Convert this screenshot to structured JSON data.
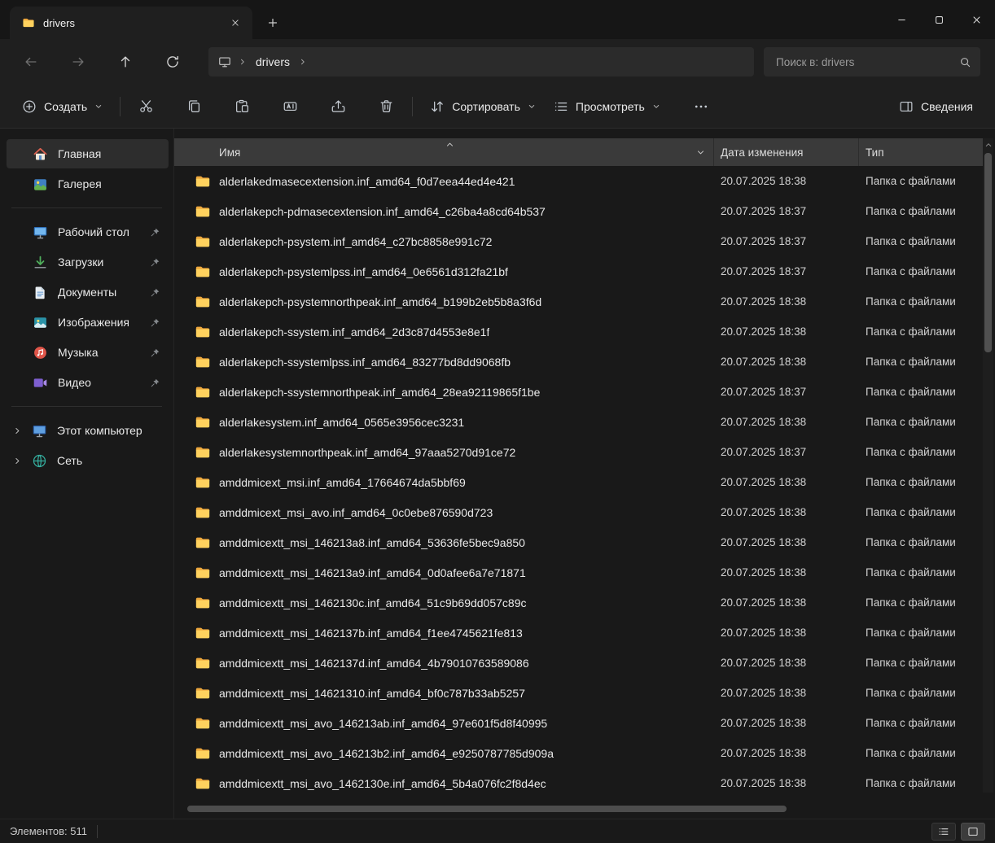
{
  "titlebar": {
    "tab_title": "drivers"
  },
  "nav": {
    "breadcrumb_label": "drivers",
    "search_placeholder": "Поиск в: drivers"
  },
  "toolbar": {
    "new_label": "Создать",
    "sort_label": "Сортировать",
    "view_label": "Просмотреть",
    "details_label": "Сведения",
    "icon_buttons": [
      {
        "name": "cut-button",
        "icon": "cut-icon"
      },
      {
        "name": "copy-button",
        "icon": "copy-icon"
      },
      {
        "name": "paste-button",
        "icon": "paste-icon"
      },
      {
        "name": "rename-button",
        "icon": "rename-icon"
      },
      {
        "name": "share-button",
        "icon": "share-icon"
      },
      {
        "name": "delete-button",
        "icon": "delete-icon"
      }
    ]
  },
  "sidebar": {
    "quick": [
      {
        "id": "sidebar-item-home",
        "label": "Главная",
        "icon": "home-icon",
        "selected": true
      },
      {
        "id": "sidebar-item-gallery",
        "label": "Галерея",
        "icon": "gallery-icon"
      }
    ],
    "pinned": [
      {
        "id": "sidebar-item-desktop",
        "label": "Рабочий стол",
        "icon": "desktop-icon",
        "pinned": true
      },
      {
        "id": "sidebar-item-downloads",
        "label": "Загрузки",
        "icon": "downloads-icon",
        "pinned": true
      },
      {
        "id": "sidebar-item-documents",
        "label": "Документы",
        "icon": "documents-icon",
        "pinned": true
      },
      {
        "id": "sidebar-item-pictures",
        "label": "Изображения",
        "icon": "pictures-icon",
        "pinned": true
      },
      {
        "id": "sidebar-item-music",
        "label": "Музыка",
        "icon": "music-icon",
        "pinned": true
      },
      {
        "id": "sidebar-item-videos",
        "label": "Видео",
        "icon": "video-icon",
        "pinned": true
      }
    ],
    "tree": [
      {
        "id": "sidebar-item-this-pc",
        "label": "Этот компьютер",
        "icon": "this-pc-icon",
        "expandable": true
      },
      {
        "id": "sidebar-item-network",
        "label": "Сеть",
        "icon": "network-icon",
        "expandable": true
      }
    ]
  },
  "list": {
    "columns": {
      "name": "Имя",
      "date": "Дата изменения",
      "type": "Тип"
    },
    "rows": [
      {
        "name": "alderlakedmasecextension.inf_amd64_f0d7eea44ed4e421",
        "date": "20.07.2025 18:38",
        "type": "Папка с файлами"
      },
      {
        "name": "alderlakepch-pdmasecextension.inf_amd64_c26ba4a8cd64b537",
        "date": "20.07.2025 18:37",
        "type": "Папка с файлами"
      },
      {
        "name": "alderlakepch-psystem.inf_amd64_c27bc8858e991c72",
        "date": "20.07.2025 18:37",
        "type": "Папка с файлами"
      },
      {
        "name": "alderlakepch-psystemlpss.inf_amd64_0e6561d312fa21bf",
        "date": "20.07.2025 18:37",
        "type": "Папка с файлами"
      },
      {
        "name": "alderlakepch-psystemnorthpeak.inf_amd64_b199b2eb5b8a3f6d",
        "date": "20.07.2025 18:38",
        "type": "Папка с файлами"
      },
      {
        "name": "alderlakepch-ssystem.inf_amd64_2d3c87d4553e8e1f",
        "date": "20.07.2025 18:38",
        "type": "Папка с файлами"
      },
      {
        "name": "alderlakepch-ssystemlpss.inf_amd64_83277bd8dd9068fb",
        "date": "20.07.2025 18:38",
        "type": "Папка с файлами"
      },
      {
        "name": "alderlakepch-ssystemnorthpeak.inf_amd64_28ea92119865f1be",
        "date": "20.07.2025 18:37",
        "type": "Папка с файлами"
      },
      {
        "name": "alderlakesystem.inf_amd64_0565e3956cec3231",
        "date": "20.07.2025 18:38",
        "type": "Папка с файлами"
      },
      {
        "name": "alderlakesystemnorthpeak.inf_amd64_97aaa5270d91ce72",
        "date": "20.07.2025 18:37",
        "type": "Папка с файлами"
      },
      {
        "name": "amddmicext_msi.inf_amd64_17664674da5bbf69",
        "date": "20.07.2025 18:38",
        "type": "Папка с файлами"
      },
      {
        "name": "amddmicext_msi_avo.inf_amd64_0c0ebe876590d723",
        "date": "20.07.2025 18:38",
        "type": "Папка с файлами"
      },
      {
        "name": "amddmicextt_msi_146213a8.inf_amd64_53636fe5bec9a850",
        "date": "20.07.2025 18:38",
        "type": "Папка с файлами"
      },
      {
        "name": "amddmicextt_msi_146213a9.inf_amd64_0d0afee6a7e71871",
        "date": "20.07.2025 18:38",
        "type": "Папка с файлами"
      },
      {
        "name": "amddmicextt_msi_1462130c.inf_amd64_51c9b69dd057c89c",
        "date": "20.07.2025 18:38",
        "type": "Папка с файлами"
      },
      {
        "name": "amddmicextt_msi_1462137b.inf_amd64_f1ee4745621fe813",
        "date": "20.07.2025 18:38",
        "type": "Папка с файлами"
      },
      {
        "name": "amddmicextt_msi_1462137d.inf_amd64_4b79010763589086",
        "date": "20.07.2025 18:38",
        "type": "Папка с файлами"
      },
      {
        "name": "amddmicextt_msi_14621310.inf_amd64_bf0c787b33ab5257",
        "date": "20.07.2025 18:38",
        "type": "Папка с файлами"
      },
      {
        "name": "amddmicextt_msi_avo_146213ab.inf_amd64_97e601f5d8f40995",
        "date": "20.07.2025 18:38",
        "type": "Папка с файлами"
      },
      {
        "name": "amddmicextt_msi_avo_146213b2.inf_amd64_e9250787785d909a",
        "date": "20.07.2025 18:38",
        "type": "Папка с файлами"
      },
      {
        "name": "amddmicextt_msi_avo_1462130e.inf_amd64_5b4a076fc2f8d4ec",
        "date": "20.07.2025 18:38",
        "type": "Папка с файлами"
      }
    ]
  },
  "statusbar": {
    "items_label": "Элементов: 511"
  }
}
